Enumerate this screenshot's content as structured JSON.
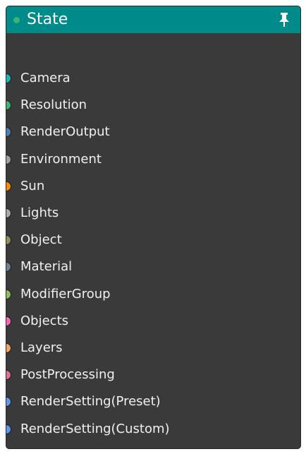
{
  "node": {
    "title": "State",
    "header_color": "#008b8b",
    "status_dot_color": "#3cb371",
    "pin_icon": "pin-icon",
    "ports": [
      {
        "label": "Camera",
        "color": "#1fb5b5"
      },
      {
        "label": "Resolution",
        "color": "#3cb371"
      },
      {
        "label": "RenderOutput",
        "color": "#4682b4"
      },
      {
        "label": "Environment",
        "color": "#a0a0a0"
      },
      {
        "label": "Sun",
        "color": "#ff8c00"
      },
      {
        "label": "Lights",
        "color": "#a9a9a9"
      },
      {
        "label": "Object",
        "color": "#8f8f5a"
      },
      {
        "label": "Material",
        "color": "#708090"
      },
      {
        "label": "ModifierGroup",
        "color": "#8fbc5f"
      },
      {
        "label": "Objects",
        "color": "#ff69b4"
      },
      {
        "label": "Layers",
        "color": "#f4a460"
      },
      {
        "label": "PostProcessing",
        "color": "#db7093"
      },
      {
        "label": "RenderSetting(Preset)",
        "color": "#6495ed"
      },
      {
        "label": "RenderSetting(Custom)",
        "color": "#6495ed"
      }
    ]
  }
}
